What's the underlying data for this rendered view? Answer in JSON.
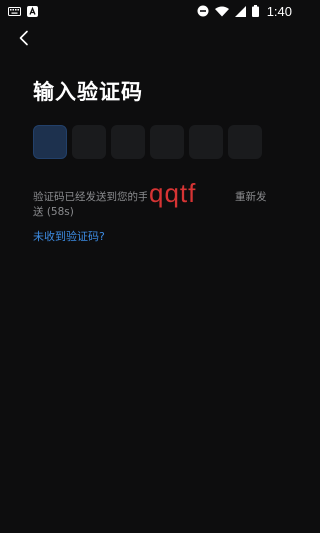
{
  "status_bar": {
    "time": "1:40",
    "icons": [
      "keyboard-icon",
      "app-a-icon",
      "do-not-disturb-icon",
      "wifi-icon",
      "signal-icon",
      "battery-icon"
    ]
  },
  "header": {
    "back_icon": "chevron-left-icon",
    "title": "输入验证码"
  },
  "code_input": {
    "length": 6,
    "active_index": 0
  },
  "info": {
    "message": "验证码已经发送到您的手机",
    "countdown": "送 (58s)",
    "resend_label": "重新发",
    "overlay_text": "qqtf"
  },
  "help": {
    "not_received_label": "未收到验证码?"
  },
  "colors": {
    "background": "#0d0d0e",
    "box": "#1a1b1d",
    "active_box": "#1d314e",
    "link": "#3c8be2",
    "overlay": "#d63434"
  }
}
